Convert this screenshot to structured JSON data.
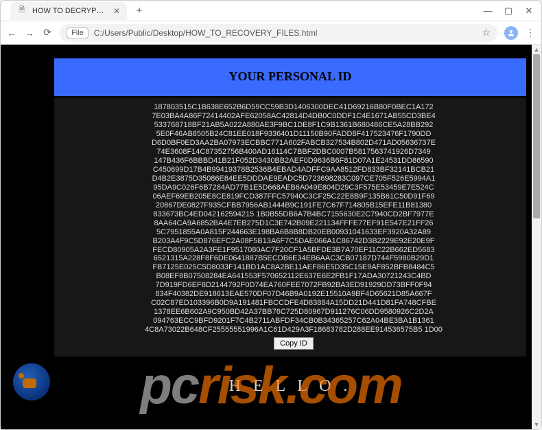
{
  "window": {
    "tab_title": "HOW TO DECRYPT YOUR FILES",
    "url": "C:/Users/Public/Desktop/HOW_TO_RECOVERY_FILES.html",
    "file_chip": "File"
  },
  "page": {
    "header": "YOUR PERSONAL ID",
    "id_lines": [
      "187803515C1B638E652B6D59CC59B3D1406300DEC41D69216B80F0BEC1A172",
      "7E03BA4A86F72414402AFE62058AC42814D4DB0C0DDF1C4E1671AB55CD3BE4",
      "533768718BF21AB5A022A880AE3F9BC1DE8F1C9B1361B680486CE5A28BB292",
      "5E0F46AB8505B24C81EE018F9336401D11150B90FADD8F417523476F1790DD",
      "D6D0BF0ED3AA2BA07973ECBBC771A602FABCB327534B802D471AD05636737E",
      "74E3608F14C87352756B400AD16114C7BBF2DBC0007B5817563741926D7349",
      "147B436F6BBBD41B21F052D3430BB2AEF0D9636B6F81D07A1E24531DD86590",
      "C450699D17B4B99419378B2536B4EBAD4ADFFC9AA8512FD833BF32141BCB21",
      "D4B2E3875D35086E84EE5DDDAE9EADC5D723698283C097CE705F526E5994A1",
      "95DA9C026F6B7284AD77B1E5D668AEB6A049E804D29C3F575E53459E7E524C",
      "06AEF69EB205E8CE819FCD387FFC57940C3CF25C22E8B9F135B61C50D91F69",
      "20867DE0827F935CFBB7956AB1444B9C191FE7C67F714805B15EFE11B81380",
      "833673BC4ED042162594215 1B0B55DB6A7B4BC7155630E2C7940CD2BF7977E",
      "8AA64CA9A6852BA4E7EB275D1C3E742B09E221134FFFE77EF91E547E21FF26",
      "5C7951855A0A815F244663E198BA6B8B8DB20EB00931041633EF3920A32A89",
      "B203A4F9C5D876EFC2A08F5B13A6F7C5DAE066A1C86742D3B2229E92E20E9F",
      "FECD80905A2A3FE1F9517080AC7F20CF1A5BFDE3B7A70EF11C22B662ED5683",
      "6521315A228F8F6DE0641887B5ECDB6E34EB6AAC3CB07187D744F5980B29D1",
      "FB7125E025C5D8033F141BD1AC8A2BE11AEF86E5D35C15E9AF852BFB8484C5",
      "B08EF8B07508284EA641553F570652112E637E6E2FB1F17ADA30721243C4BD",
      "7D919FD6EF8D2144792F0D74EA760FEE7072FB92BA3ED91929DD73BFF0F94",
      "834F40382DE918613EAE570DF07D46B9A0192E15510A9BF4D65621D85A667F",
      "C02C87ED103396B0D9A191481FBCCDFE4D83884A15DD21D441D81FA748CFBE",
      "1378EE6B602A9C950BD42A37BB76C725D80967D911276C06DD9580926C2D2A",
      "094763ECC9BFD9201F7C4B2711ABFDF34CB0B34365257C62A04BE3BA1B1361",
      "4C8A73022B648CF25555551996A1C61D429A3F18683782D288EE914536575B5 1D00"
    ],
    "copy_label": "Copy ID",
    "hello": "H E L L O ."
  },
  "watermark": {
    "prefix": "pc",
    "suffix": "risk.com"
  }
}
